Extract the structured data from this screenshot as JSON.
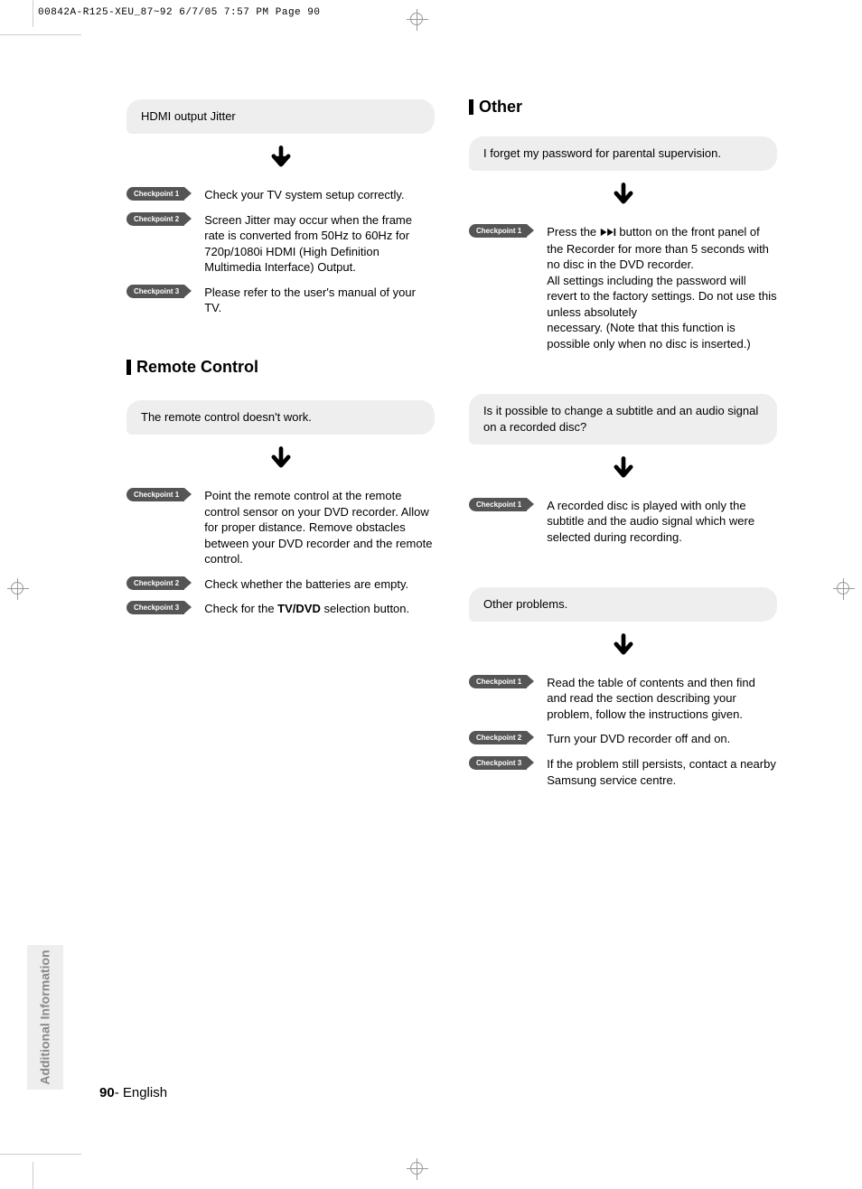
{
  "slug": "00842A-R125-XEU_87~92  6/7/05  7:57 PM  Page 90",
  "side_tab": "Additional Information",
  "page_number": "90",
  "page_lang": "English",
  "left": {
    "hdmi": {
      "issue": "HDMI output Jitter",
      "cp1_label": "Checkpoint 1",
      "cp1_text": "Check your TV system setup correctly.",
      "cp2_label": "Checkpoint 2",
      "cp2_text": "Screen Jitter may occur when the frame rate is converted from 50Hz to 60Hz for 720p/1080i HDMI (High Definition Multimedia Interface) Output.",
      "cp3_label": "Checkpoint 3",
      "cp3_text": "Please refer to the user's manual of your TV."
    },
    "remote_title": "Remote Control",
    "remote": {
      "issue": "The remote control doesn't work.",
      "cp1_label": "Checkpoint 1",
      "cp1_text": "Point the remote control at the remote control sensor on your DVD recorder. Allow for proper distance. Remove obstacles between your DVD recorder and the remote control.",
      "cp2_label": "Checkpoint 2",
      "cp2_text": "Check whether the batteries are empty.",
      "cp3_label": "Checkpoint 3",
      "cp3_pre": "Check for the ",
      "cp3_bold": "TV/DVD",
      "cp3_post": " selection button."
    }
  },
  "right": {
    "other_title": "Other",
    "password": {
      "issue": "I forget my password for parental supervision.",
      "cp1_label": "Checkpoint 1",
      "cp1_pre": "Press the ",
      "cp1_post": " button on the front panel of the Recorder for more than 5 seconds with no disc in the DVD recorder.\nAll settings including the password will revert to the factory settings. Do not use this unless absolutely\nnecessary. (Note that this function is possible only when no disc is inserted.)"
    },
    "subtitle": {
      "issue": "Is it possible to change a subtitle and an audio signal on a recorded disc?",
      "cp1_label": "Checkpoint 1",
      "cp1_text": "A recorded disc is played with only the subtitle and the audio signal which were selected during recording."
    },
    "other_problems": {
      "issue": "Other problems.",
      "cp1_label": "Checkpoint 1",
      "cp1_text": "Read the table of contents and then find and read the section describing your problem, follow the instructions given.",
      "cp2_label": "Checkpoint 2",
      "cp2_text": "Turn your DVD recorder off and on.",
      "cp3_label": "Checkpoint 3",
      "cp3_text": "If the problem still persists, contact a nearby Samsung service centre."
    }
  }
}
